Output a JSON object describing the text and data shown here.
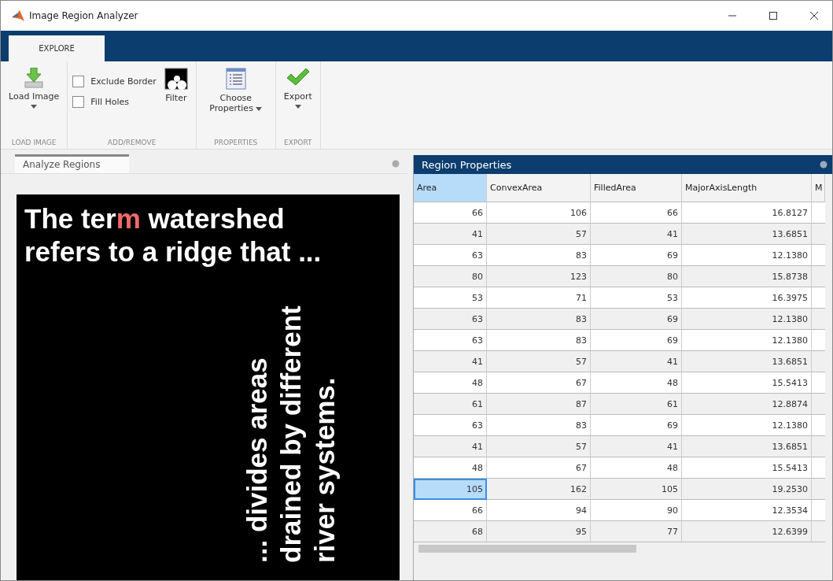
{
  "window": {
    "title": "Image Region Analyzer"
  },
  "ribbon_tabs": [
    {
      "label": "EXPLORE",
      "selected": true
    }
  ],
  "toolstrip": {
    "load_image": {
      "button": "Load Image",
      "label": "LOAD IMAGE"
    },
    "add_remove": {
      "checkboxes": [
        {
          "label": "Exclude Border",
          "checked": false
        },
        {
          "label": "Fill Holes",
          "checked": false
        }
      ],
      "filter_button": "Filter",
      "label": "ADD/REMOVE"
    },
    "properties": {
      "button": "Choose Properties",
      "label": "PROPERTIES"
    },
    "export": {
      "button": "Export",
      "label": "EXPORT"
    }
  },
  "image_panel": {
    "tab": "Analyze Regions",
    "image_lines": [
      [
        {
          "text": "The ter",
          "highlight": false
        },
        {
          "text": "m",
          "highlight": true
        },
        {
          "text": " watershed",
          "highlight": false
        }
      ],
      [
        {
          "text": "refers to a ridge that ...",
          "highlight": false
        }
      ]
    ],
    "vertical_lines": [
      "... divides areas",
      "drained by different",
      "river systems."
    ]
  },
  "table_panel": {
    "title": "Region Properties",
    "columns": [
      {
        "label": "Area",
        "selected": true
      },
      {
        "label": "ConvexArea",
        "selected": false
      },
      {
        "label": "FilledArea",
        "selected": false
      },
      {
        "label": "MajorAxisLength",
        "selected": false
      },
      {
        "label": "M",
        "selected": false
      }
    ],
    "rows": [
      {
        "cells": [
          "66",
          "106",
          "66",
          "16.8127"
        ],
        "selected": false
      },
      {
        "cells": [
          "41",
          "57",
          "41",
          "13.6851"
        ],
        "selected": false
      },
      {
        "cells": [
          "63",
          "83",
          "69",
          "12.1380"
        ],
        "selected": false
      },
      {
        "cells": [
          "80",
          "123",
          "80",
          "15.8738"
        ],
        "selected": false
      },
      {
        "cells": [
          "53",
          "71",
          "53",
          "16.3975"
        ],
        "selected": false
      },
      {
        "cells": [
          "63",
          "83",
          "69",
          "12.1380"
        ],
        "selected": false
      },
      {
        "cells": [
          "63",
          "83",
          "69",
          "12.1380"
        ],
        "selected": false
      },
      {
        "cells": [
          "41",
          "57",
          "41",
          "13.6851"
        ],
        "selected": false
      },
      {
        "cells": [
          "48",
          "67",
          "48",
          "15.5413"
        ],
        "selected": false
      },
      {
        "cells": [
          "61",
          "87",
          "61",
          "12.8874"
        ],
        "selected": false
      },
      {
        "cells": [
          "63",
          "83",
          "69",
          "12.1380"
        ],
        "selected": false
      },
      {
        "cells": [
          "41",
          "57",
          "41",
          "13.6851"
        ],
        "selected": false
      },
      {
        "cells": [
          "48",
          "67",
          "48",
          "15.5413"
        ],
        "selected": false
      },
      {
        "cells": [
          "105",
          "162",
          "105",
          "19.2530"
        ],
        "selected": true
      },
      {
        "cells": [
          "66",
          "94",
          "90",
          "12.3534"
        ],
        "selected": false
      },
      {
        "cells": [
          "68",
          "95",
          "77",
          "12.6399"
        ],
        "selected": false
      }
    ]
  }
}
